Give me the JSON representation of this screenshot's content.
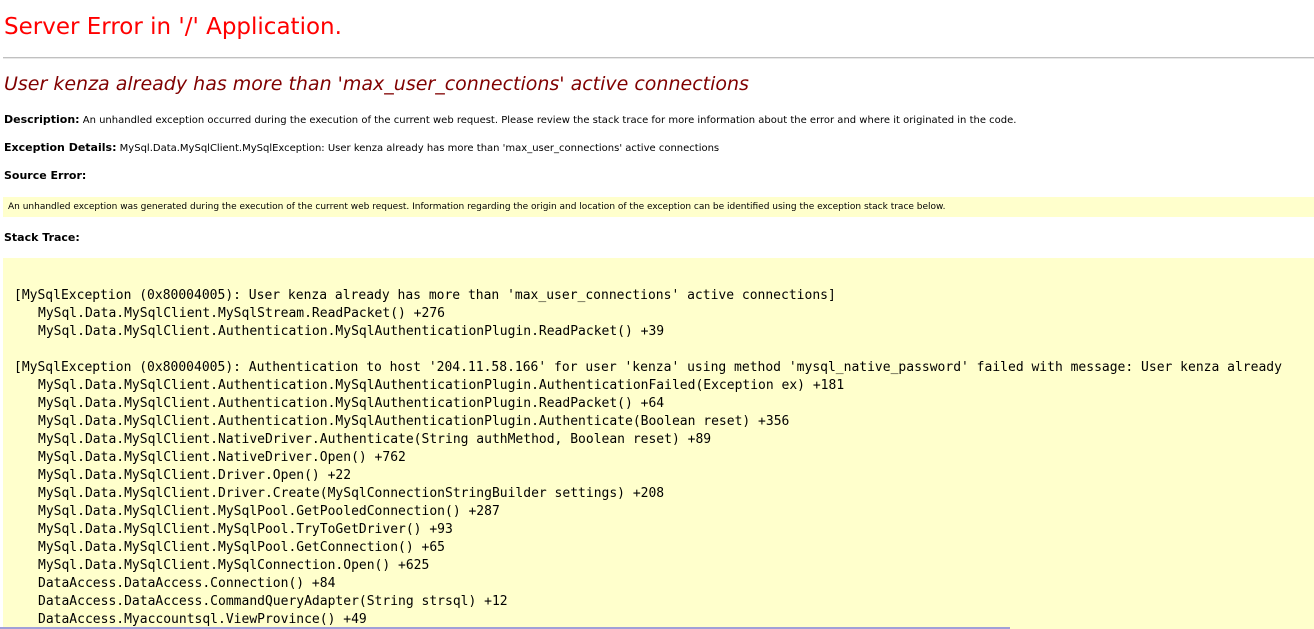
{
  "page": {
    "title": "Server Error in '/' Application.",
    "error_message": "User kenza already has more than 'max_user_connections' active connections",
    "description_label": "Description:",
    "description_text": "An unhandled exception occurred during the execution of the current web request. Please review the stack trace for more information about the error and where it originated in the code.",
    "exception_label": "Exception Details:",
    "exception_text": "MySql.Data.MySqlClient.MySqlException: User kenza already has more than 'max_user_connections' active connections",
    "source_error_label": "Source Error:",
    "source_error_text": "An unhandled exception was generated during the execution of the current web request. Information regarding the origin and location of the exception can be identified using the exception stack trace below.",
    "stack_trace_label": "Stack Trace:"
  },
  "colors": {
    "title": "#ff0000",
    "error_message": "#800000",
    "code_background": "#ffffcc"
  },
  "stack_trace": [
    "[MySqlException (0x80004005): User kenza already has more than 'max_user_connections' active connections]",
    "MySql.Data.MySqlClient.MySqlStream.ReadPacket() +276",
    "MySql.Data.MySqlClient.Authentication.MySqlAuthenticationPlugin.ReadPacket() +39",
    "[MySqlException (0x80004005): Authentication to host '204.11.58.166' for user 'kenza' using method 'mysql_native_password' failed with message: User kenza already",
    "MySql.Data.MySqlClient.Authentication.MySqlAuthenticationPlugin.AuthenticationFailed(Exception ex) +181",
    "MySql.Data.MySqlClient.Authentication.MySqlAuthenticationPlugin.ReadPacket() +64",
    "MySql.Data.MySqlClient.Authentication.MySqlAuthenticationPlugin.Authenticate(Boolean reset) +356",
    "MySql.Data.MySqlClient.NativeDriver.Authenticate(String authMethod, Boolean reset) +89",
    "MySql.Data.MySqlClient.NativeDriver.Open() +762",
    "MySql.Data.MySqlClient.Driver.Open() +22",
    "MySql.Data.MySqlClient.Driver.Create(MySqlConnectionStringBuilder settings) +208",
    "MySql.Data.MySqlClient.MySqlPool.GetPooledConnection() +287",
    "MySql.Data.MySqlClient.MySqlPool.TryToGetDriver() +93",
    "MySql.Data.MySqlClient.MySqlPool.GetConnection() +65",
    "MySql.Data.MySqlClient.MySqlConnection.Open() +625",
    "DataAccess.DataAccess.Connection() +84",
    "DataAccess.DataAccess.CommandQueryAdapter(String strsql) +12",
    "DataAccess.Myaccountsql.ViewProvince() +49"
  ]
}
